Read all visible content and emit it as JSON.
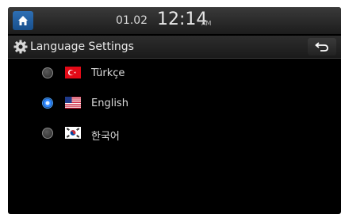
{
  "status": {
    "date": "01.02",
    "time": "12:14",
    "ampm": "AM"
  },
  "header": {
    "title": "Language Settings"
  },
  "languages": [
    {
      "label": "Türkçe",
      "selected": false,
      "flag": "turkey-flag-icon"
    },
    {
      "label": "English",
      "selected": true,
      "flag": "usa-flag-icon"
    },
    {
      "label": "한국어",
      "selected": false,
      "flag": "korea-flag-icon"
    }
  ],
  "colors": {
    "accent": "#2d86ff",
    "home_button": "#1f5fa0",
    "background": "#000000"
  }
}
